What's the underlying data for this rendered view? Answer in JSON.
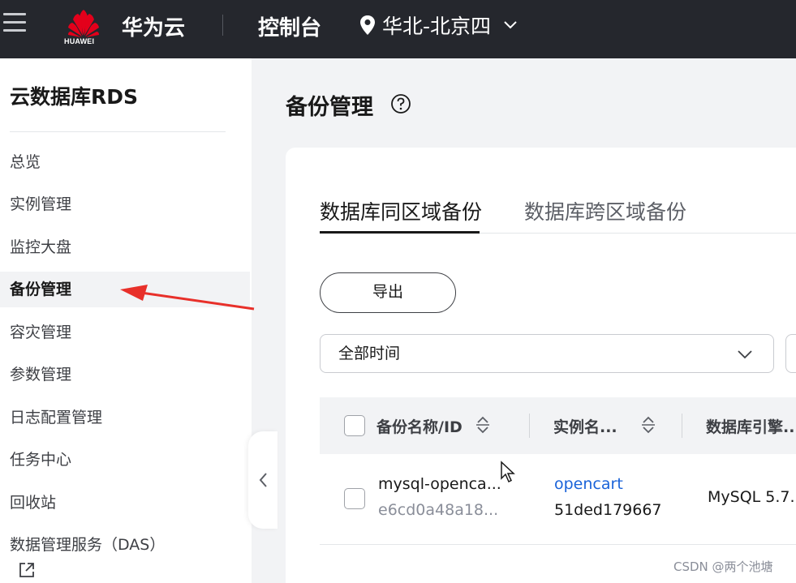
{
  "header": {
    "logo_text": "HUAWEI",
    "brand": "华为云",
    "console": "控制台",
    "region": "华北-北京四"
  },
  "sidebar": {
    "title": "云数据库RDS",
    "items": [
      {
        "label": "总览"
      },
      {
        "label": "实例管理"
      },
      {
        "label": "监控大盘"
      },
      {
        "label": "备份管理",
        "active": true
      },
      {
        "label": "容灾管理"
      },
      {
        "label": "参数管理"
      },
      {
        "label": "日志配置管理"
      },
      {
        "label": "任务中心"
      },
      {
        "label": "回收站"
      },
      {
        "label": "数据管理服务（DAS）"
      }
    ]
  },
  "main": {
    "title": "备份管理",
    "tabs": [
      {
        "label": "数据库同区域备份",
        "active": true
      },
      {
        "label": "数据库跨区域备份"
      }
    ],
    "export_label": "导出",
    "time_filter": "全部时间",
    "table": {
      "columns": [
        "备份名称/ID",
        "实例名...",
        "数据库引擎..."
      ],
      "rows": [
        {
          "name": "mysql-openca...",
          "id": "e6cd0a48a18...",
          "instance_name": "opencart",
          "instance_id": "51ded179667",
          "engine": "MySQL 5.7."
        }
      ]
    }
  },
  "watermark": "CSDN @两个池塘",
  "colors": {
    "topbar": "#25272d",
    "link": "#1a63d9",
    "logo_red": "#e3001b",
    "arrow_red": "#e8302a"
  }
}
